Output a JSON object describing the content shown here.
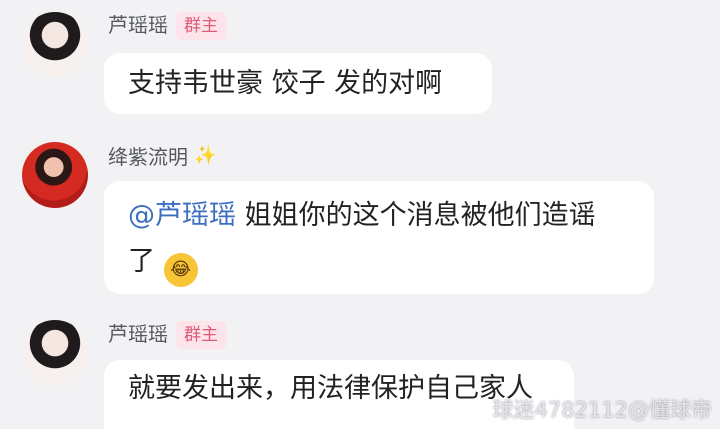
{
  "messages": [
    {
      "sender": "芦瑶瑶",
      "badge": "群主",
      "text": "支持韦世豪 饺子 发的对啊"
    },
    {
      "sender": "绛紫流明",
      "sparkle": "✨",
      "mention": "@芦瑶瑶",
      "text_line1": " 姐姐你的这个消息被他们造谣",
      "text_line2": "了",
      "emoji": "😂"
    },
    {
      "sender": "芦瑶瑶",
      "badge": "群主",
      "text": "就要发出来，用法律保护自己家人"
    }
  ],
  "watermark": "球迷4782112@懂球帝"
}
